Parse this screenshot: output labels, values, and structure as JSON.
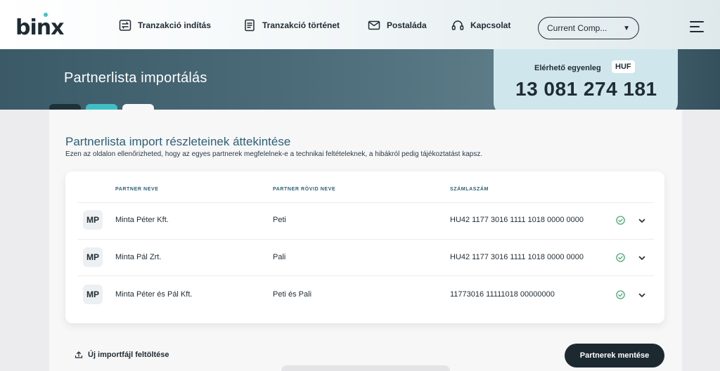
{
  "app": {
    "logo": "binx"
  },
  "nav": {
    "items": [
      {
        "label": "Tranzakció indítás",
        "icon": "transfer-icon"
      },
      {
        "label": "Tranzakció történet",
        "icon": "document-icon"
      },
      {
        "label": "Postaláda",
        "icon": "mail-icon"
      },
      {
        "label": "Kapcsolat",
        "icon": "headset-icon"
      }
    ],
    "company_select": "Current Comp...",
    "menu_icon": "hamburger-menu-icon"
  },
  "hero": {
    "title": "Partnerlista importálás"
  },
  "balance": {
    "label": "Elérhető egyenleg",
    "currency": "HUF",
    "amount": "13 081 274 181"
  },
  "section": {
    "title": "Partnerlista import részleteinek áttekintése",
    "description": "Ezen az oldalon ellenőrizheted, hogy az egyes partnerek megfelelnek-e a technikai feltételeknek, a hibákról pedig tájékoztatást kapsz."
  },
  "table": {
    "headers": [
      "PARTNER NEVE",
      "PARTNER RÖVID NEVE",
      "SZÁMLASZÁM"
    ],
    "rows": [
      {
        "initials": "MP",
        "name": "Minta Péter Kft.",
        "short": "Peti",
        "account": "HU42 1177 3016 1111 1018 0000 0000",
        "status": "valid"
      },
      {
        "initials": "MP",
        "name": "Minta Pál Zrt.",
        "short": "Pali",
        "account": "HU42 1177 3016 1111 1018 0000 0000",
        "status": "valid"
      },
      {
        "initials": "MP",
        "name": "Minta Péter és Pál Kft.",
        "short": "Peti és Pali",
        "account": "11773016 11111018 00000000",
        "status": "valid"
      }
    ]
  },
  "actions": {
    "upload_label": "Új importfájl feltöltése",
    "save_label": "Partnerek mentése"
  },
  "colors": {
    "accent": "#2d5f75",
    "check": "#3fa36b",
    "dark": "#1d2930",
    "balance_bg": "#cfe7ec"
  }
}
